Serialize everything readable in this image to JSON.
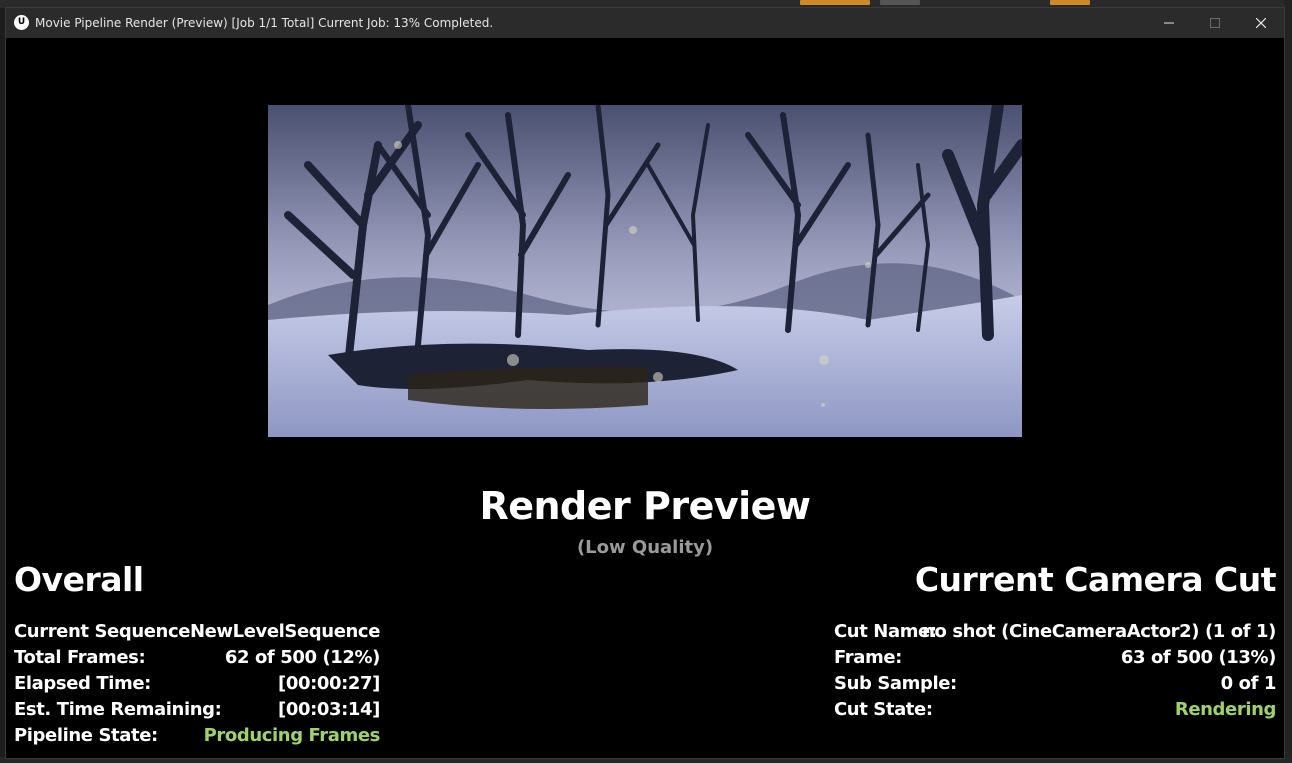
{
  "window": {
    "title": "Movie Pipeline Render (Preview) [Job 1/1 Total] Current Job: 13% Completed.",
    "app_logo": "U",
    "controls": [
      "minimize-icon",
      "maximize-icon",
      "close-icon"
    ]
  },
  "preview": {
    "heading": "Render Preview",
    "subheading": "(Low Quality)"
  },
  "overall": {
    "title": "Overall",
    "rows": [
      {
        "label": "Current Sequence:",
        "value": "NewLevelSequence",
        "highlight": false
      },
      {
        "label": "Total Frames:",
        "value": "62 of 500 (12%)",
        "highlight": false
      },
      {
        "label": "Elapsed Time:",
        "value": "[00:00:27]",
        "highlight": false
      },
      {
        "label": "Est. Time Remaining:",
        "value": "[00:03:14]",
        "highlight": false
      },
      {
        "label": "Pipeline State:",
        "value": "Producing Frames",
        "highlight": true
      }
    ]
  },
  "camera_cut": {
    "title": "Current Camera Cut",
    "rows": [
      {
        "label": "Cut Name:",
        "value": "no shot (CineCameraActor2) (1 of 1)",
        "highlight": false
      },
      {
        "label": "Frame:",
        "value": "63 of 500 (13%)",
        "highlight": false
      },
      {
        "label": "Sub Sample:",
        "value": "0 of 1",
        "highlight": false
      },
      {
        "label": "Cut State:",
        "value": "Rendering",
        "highlight": true
      }
    ]
  },
  "colors": {
    "highlight": "#9ed36a",
    "background": "#000000",
    "titlebar": "#2b2b2b"
  }
}
